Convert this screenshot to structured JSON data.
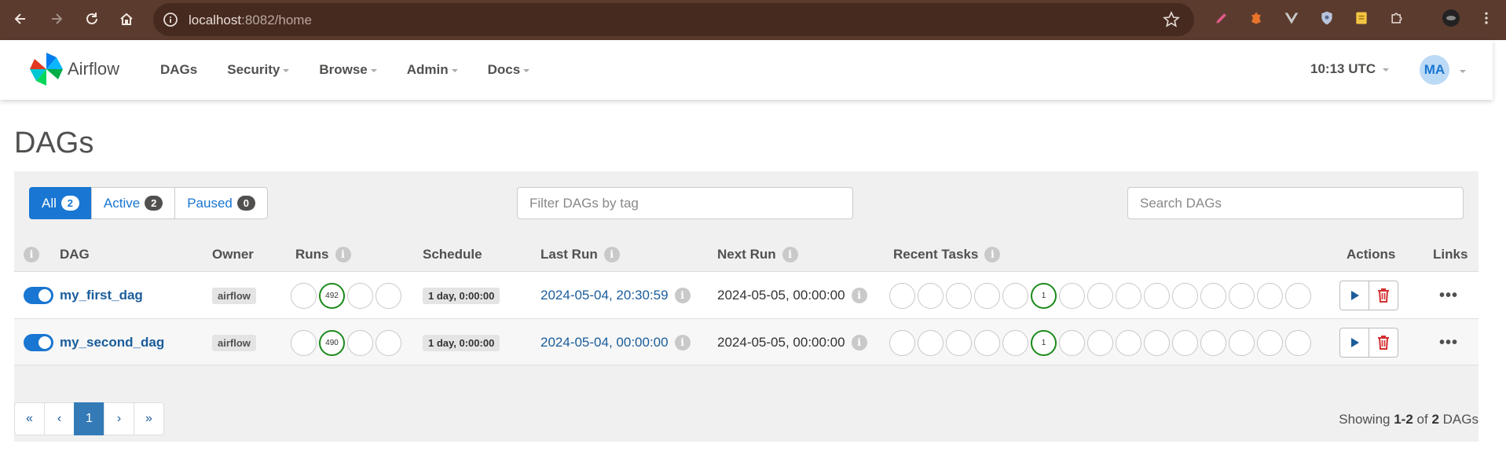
{
  "browser": {
    "url_host": "localhost",
    "url_rest": ":8082/home"
  },
  "navbar": {
    "brand": "Airflow",
    "menu": [
      "DAGs",
      "Security",
      "Browse",
      "Admin",
      "Docs"
    ],
    "clock": "10:13 UTC",
    "user_initials": "MA"
  },
  "page": {
    "title": "DAGs"
  },
  "filters": {
    "all": {
      "label": "All",
      "count": "2"
    },
    "active": {
      "label": "Active",
      "count": "2"
    },
    "paused": {
      "label": "Paused",
      "count": "0"
    },
    "tag_placeholder": "Filter DAGs by tag",
    "search_placeholder": "Search DAGs"
  },
  "table": {
    "headers": {
      "dag": "DAG",
      "owner": "Owner",
      "runs": "Runs",
      "schedule": "Schedule",
      "last_run": "Last Run",
      "next_run": "Next Run",
      "recent_tasks": "Recent Tasks",
      "actions": "Actions",
      "links": "Links"
    },
    "rows": [
      {
        "dag_id": "my_first_dag",
        "owner": "airflow",
        "runs_success": "492",
        "schedule": "1 day, 0:00:00",
        "last_run": "2024-05-04, 20:30:59",
        "next_run": "2024-05-05, 00:00:00",
        "recent_success": "1"
      },
      {
        "dag_id": "my_second_dag",
        "owner": "airflow",
        "runs_success": "490",
        "schedule": "1 day, 0:00:00",
        "last_run": "2024-05-04, 00:00:00",
        "next_run": "2024-05-05, 00:00:00",
        "recent_success": "1"
      }
    ]
  },
  "pagination": {
    "first": "«",
    "prev": "‹",
    "current": "1",
    "next": "›",
    "last": "»"
  },
  "footer": {
    "showing_prefix": "Showing",
    "range": "1-2",
    "of": "of",
    "total": "2",
    "suffix": "DAGs"
  },
  "colors": {
    "accent": "#1976d2",
    "success": "#1a8a1a",
    "delete": "#d32f2f"
  }
}
